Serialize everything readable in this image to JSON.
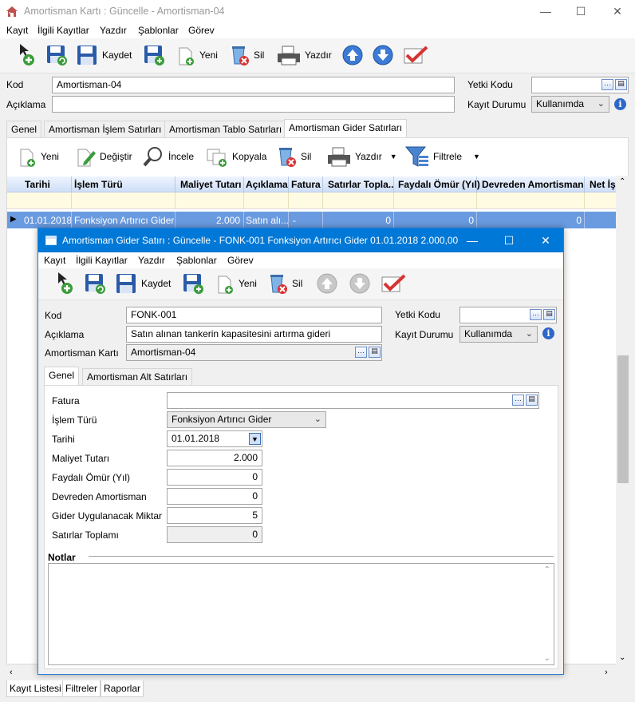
{
  "main": {
    "title": "Amortisman Kartı : Güncelle - Amortisman-04",
    "menu": [
      "Kayıt",
      "İlgili Kayıtlar",
      "Yazdır",
      "Şablonlar",
      "Görev"
    ],
    "toolbar": {
      "save": "Kaydet",
      "new": "Yeni",
      "delete": "Sil",
      "print": "Yazdır"
    },
    "form": {
      "kod_label": "Kod",
      "kod_value": "Amortisman-04",
      "aciklama_label": "Açıklama",
      "aciklama_value": "",
      "yetki_label": "Yetki Kodu",
      "yetki_value": "",
      "durum_label": "Kayıt Durumu",
      "durum_value": "Kullanımda"
    },
    "tabs": [
      "Genel",
      "Amortisman İşlem Satırları",
      "Amortisman Tablo Satırları",
      "Amortisman Gider Satırları"
    ],
    "tab_toolbar": {
      "new": "Yeni",
      "edit": "Değiştir",
      "inspect": "İncele",
      "copy": "Kopyala",
      "delete": "Sil",
      "print": "Yazdır",
      "filter": "Filtrele"
    },
    "grid": {
      "columns": [
        "Tarihi",
        "İşlem Türü",
        "Maliyet Tutarı",
        "Açıklama",
        "Fatura",
        "Satırlar Topla...",
        "Faydalı Ömür (Yıl)",
        "Devreden Amortisman",
        "Net İş"
      ],
      "row": [
        "01.01.2018",
        "Fonksiyon Artırıcı Gider",
        "2.000",
        "Satın alı...",
        "-",
        "0",
        "0",
        "0"
      ]
    },
    "status_tabs": [
      "Kayıt Listesi",
      "Filtreler",
      "Raporlar"
    ]
  },
  "child": {
    "title": "Amortisman Gider Satırı : Güncelle - FONK-001 Fonksiyon Artırıcı Gider 01.01.2018 2.000,00",
    "menu": [
      "Kayıt",
      "İlgili Kayıtlar",
      "Yazdır",
      "Şablonlar",
      "Görev"
    ],
    "toolbar": {
      "save": "Kaydet",
      "new": "Yeni",
      "delete": "Sil"
    },
    "form": {
      "kod_label": "Kod",
      "kod_value": "FONK-001",
      "aciklama_label": "Açıklama",
      "aciklama_value": "Satın alınan tankerin kapasitesini artırma gideri",
      "kart_label": "Amortisman Kartı",
      "kart_value": "Amortisman-04",
      "yetki_label": "Yetki Kodu",
      "yetki_value": "",
      "durum_label": "Kayıt Durumu",
      "durum_value": "Kullanımda"
    },
    "tabs": [
      "Genel",
      "Amortisman Alt Satırları"
    ],
    "fields": {
      "fatura_label": "Fatura",
      "fatura_value": "",
      "islem_label": "İşlem Türü",
      "islem_value": "Fonksiyon Artırıcı Gider",
      "tarih_label": "Tarihi",
      "tarih_value": "01.01.2018",
      "maliyet_label": "Maliyet Tutarı",
      "maliyet_value": "2.000",
      "omur_label": "Faydalı Ömür (Yıl)",
      "omur_value": "0",
      "devreden_label": "Devreden Amortisman",
      "devreden_value": "0",
      "gider_label": "Gider Uygulanacak Miktar",
      "gider_value": "5",
      "toplam_label": "Satırlar Toplamı",
      "toplam_value": "0"
    },
    "notes_label": "Notlar",
    "notes_value": ""
  }
}
